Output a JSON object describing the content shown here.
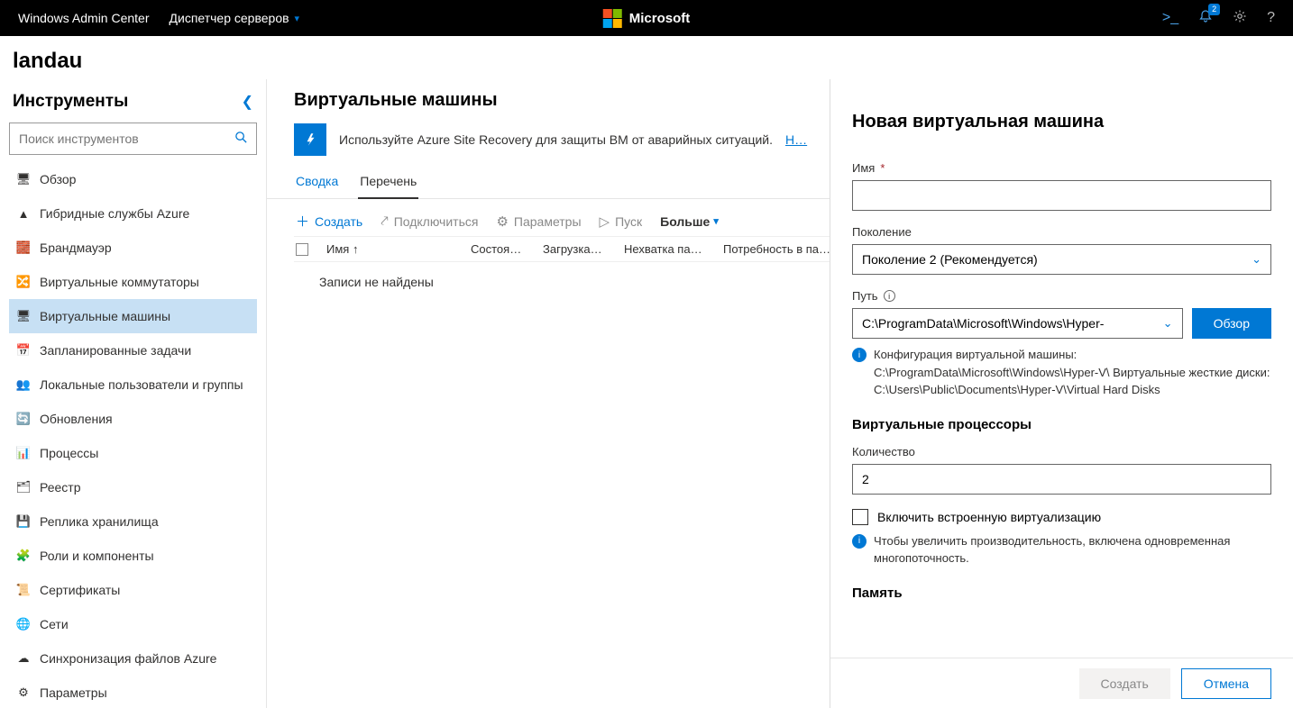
{
  "topbar": {
    "brand": "Windows Admin Center",
    "menu": "Диспетчер серверов",
    "logo": "Microsoft",
    "notif_badge": "2"
  },
  "breadcrumb": {
    "server": "landau"
  },
  "sidebar": {
    "title": "Инструменты",
    "search_placeholder": "Поиск инструментов",
    "items": [
      {
        "label": "Обзор",
        "active": false
      },
      {
        "label": "Гибридные службы Azure",
        "active": false
      },
      {
        "label": "Брандмауэр",
        "active": false
      },
      {
        "label": "Виртуальные коммутаторы",
        "active": false
      },
      {
        "label": "Виртуальные машины",
        "active": true
      },
      {
        "label": "Запланированные задачи",
        "active": false
      },
      {
        "label": "Локальные пользователи и группы",
        "active": false
      },
      {
        "label": "Обновления",
        "active": false
      },
      {
        "label": "Процессы",
        "active": false
      },
      {
        "label": "Реестр",
        "active": false
      },
      {
        "label": "Реплика хранилища",
        "active": false
      },
      {
        "label": "Роли и компоненты",
        "active": false
      },
      {
        "label": "Сертификаты",
        "active": false
      },
      {
        "label": "Сети",
        "active": false
      },
      {
        "label": "Синхронизация файлов Azure",
        "active": false
      },
      {
        "label": "Параметры",
        "active": false
      }
    ]
  },
  "main": {
    "title": "Виртуальные машины",
    "banner_text": "Используйте Azure Site Recovery для защиты ВМ от аварийных ситуаций.",
    "banner_link": "Н…",
    "tabs": {
      "summary": "Сводка",
      "inventory": "Перечень"
    },
    "toolbar": {
      "create": "Создать",
      "connect": "Подключиться",
      "settings": "Параметры",
      "start": "Пуск",
      "more": "Больше"
    },
    "columns": {
      "name": "Имя",
      "state": "Состоя…",
      "load": "Загрузка…",
      "pressure": "Нехватка па…",
      "demand": "Потребность в па…"
    },
    "no_records": "Записи не найдены"
  },
  "panel": {
    "title": "Новая виртуальная машина",
    "name_label": "Имя",
    "gen_label": "Поколение",
    "gen_value": "Поколение 2 (Рекомендуется)",
    "path_label": "Путь",
    "path_value": "C:\\ProgramData\\Microsoft\\Windows\\Hyper-",
    "browse": "Обзор",
    "path_info": "Конфигурация виртуальной машины: C:\\ProgramData\\Microsoft\\Windows\\Hyper-V\\ Виртуальные жесткие диски: C:\\Users\\Public\\Documents\\Hyper-V\\Virtual Hard Disks",
    "cpu_section": "Виртуальные процессоры",
    "count_label": "Количество",
    "count_value": "2",
    "nested_label": "Включить встроенную виртуализацию",
    "smt_info": "Чтобы увеличить производительность, включена одновременная многопоточность.",
    "mem_section": "Память",
    "footer": {
      "create": "Создать",
      "cancel": "Отмена"
    }
  }
}
